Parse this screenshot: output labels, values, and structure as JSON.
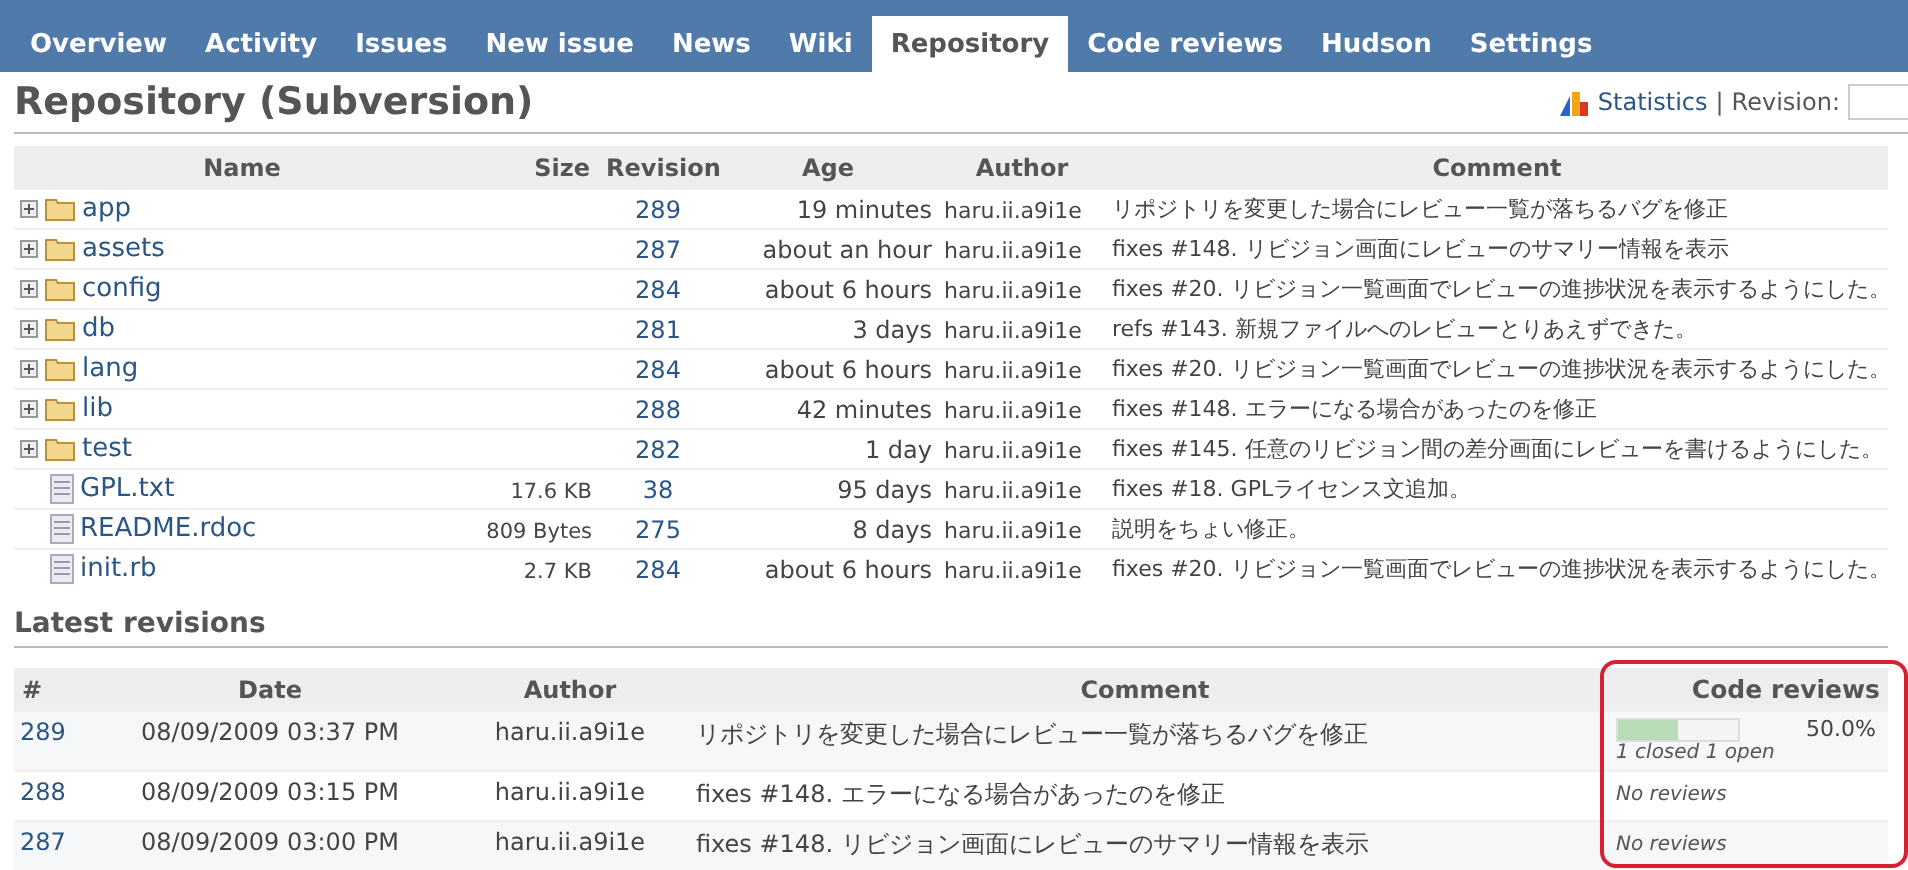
{
  "tabs": [
    {
      "label": "Overview",
      "selected": false
    },
    {
      "label": "Activity",
      "selected": false
    },
    {
      "label": "Issues",
      "selected": false
    },
    {
      "label": "New issue",
      "selected": false
    },
    {
      "label": "News",
      "selected": false
    },
    {
      "label": "Wiki",
      "selected": false
    },
    {
      "label": "Repository",
      "selected": true
    },
    {
      "label": "Code reviews",
      "selected": false
    },
    {
      "label": "Hudson",
      "selected": false
    },
    {
      "label": "Settings",
      "selected": false
    }
  ],
  "title": "Repository (Subversion)",
  "actions": {
    "statistics": "Statistics",
    "separator": "|",
    "revision_label": "Revision:"
  },
  "files": {
    "columns": [
      "Name",
      "Size",
      "Revision",
      "Age",
      "Author",
      "Comment"
    ],
    "rows": [
      {
        "kind": "folder",
        "name": "app",
        "size": "",
        "revision": "289",
        "age": "19 minutes",
        "author": "haru.ii.a9i1e",
        "comment": "リポジトリを変更した場合にレビュー一覧が落ちるバグを修正"
      },
      {
        "kind": "folder",
        "name": "assets",
        "size": "",
        "revision": "287",
        "age": "about an hour",
        "author": "haru.ii.a9i1e",
        "comment": "fixes #148. リビジョン画面にレビューのサマリー情報を表示"
      },
      {
        "kind": "folder",
        "name": "config",
        "size": "",
        "revision": "284",
        "age": "about 6 hours",
        "author": "haru.ii.a9i1e",
        "comment": "fixes #20. リビジョン一覧画面でレビューの進捗状況を表示するようにした。"
      },
      {
        "kind": "folder",
        "name": "db",
        "size": "",
        "revision": "281",
        "age": "3 days",
        "author": "haru.ii.a9i1e",
        "comment": "refs #143. 新規ファイルへのレビューとりあえずできた。"
      },
      {
        "kind": "folder",
        "name": "lang",
        "size": "",
        "revision": "284",
        "age": "about 6 hours",
        "author": "haru.ii.a9i1e",
        "comment": "fixes #20. リビジョン一覧画面でレビューの進捗状況を表示するようにした。"
      },
      {
        "kind": "folder",
        "name": "lib",
        "size": "",
        "revision": "288",
        "age": "42 minutes",
        "author": "haru.ii.a9i1e",
        "comment": "fixes #148. エラーになる場合があったのを修正"
      },
      {
        "kind": "folder",
        "name": "test",
        "size": "",
        "revision": "282",
        "age": "1 day",
        "author": "haru.ii.a9i1e",
        "comment": "fixes #145. 任意のリビジョン間の差分画面にレビューを書けるようにした。"
      },
      {
        "kind": "file",
        "name": "GPL.txt",
        "size": "17.6 KB",
        "revision": "38",
        "age": "95 days",
        "author": "haru.ii.a9i1e",
        "comment": "fixes #18. GPLライセンス文追加。"
      },
      {
        "kind": "file",
        "name": "README.rdoc",
        "size": "809 Bytes",
        "revision": "275",
        "age": "8 days",
        "author": "haru.ii.a9i1e",
        "comment": "説明をちょい修正。"
      },
      {
        "kind": "file",
        "name": "init.rb",
        "size": "2.7 KB",
        "revision": "284",
        "age": "about 6 hours",
        "author": "haru.ii.a9i1e",
        "comment": "fixes #20. リビジョン一覧画面でレビューの進捗状況を表示するようにした。"
      }
    ]
  },
  "latest": {
    "title": "Latest revisions",
    "columns": [
      "#",
      "Date",
      "Author",
      "Comment",
      "Code reviews"
    ],
    "rows": [
      {
        "revision": "289",
        "date": "08/09/2009 03:37 PM",
        "author": "haru.ii.a9i1e",
        "comment": "リポジトリを変更した場合にレビュー一覧が落ちるバグを修正",
        "review": {
          "kind": "progress",
          "level": 0.5,
          "percent": "50.0%",
          "summary": "1 closed 1 open"
        }
      },
      {
        "revision": "288",
        "date": "08/09/2009 03:15 PM",
        "author": "haru.ii.a9i1e",
        "comment": "fixes #148. エラーになる場合があったのを修正",
        "review": {
          "kind": "none",
          "text": "No reviews"
        }
      },
      {
        "revision": "287",
        "date": "08/09/2009 03:00 PM",
        "author": "haru.ii.a9i1e",
        "comment": "fixes #148. リビジョン画面にレビューのサマリー情報を表示",
        "review": {
          "kind": "none",
          "text": "No reviews"
        }
      }
    ]
  }
}
